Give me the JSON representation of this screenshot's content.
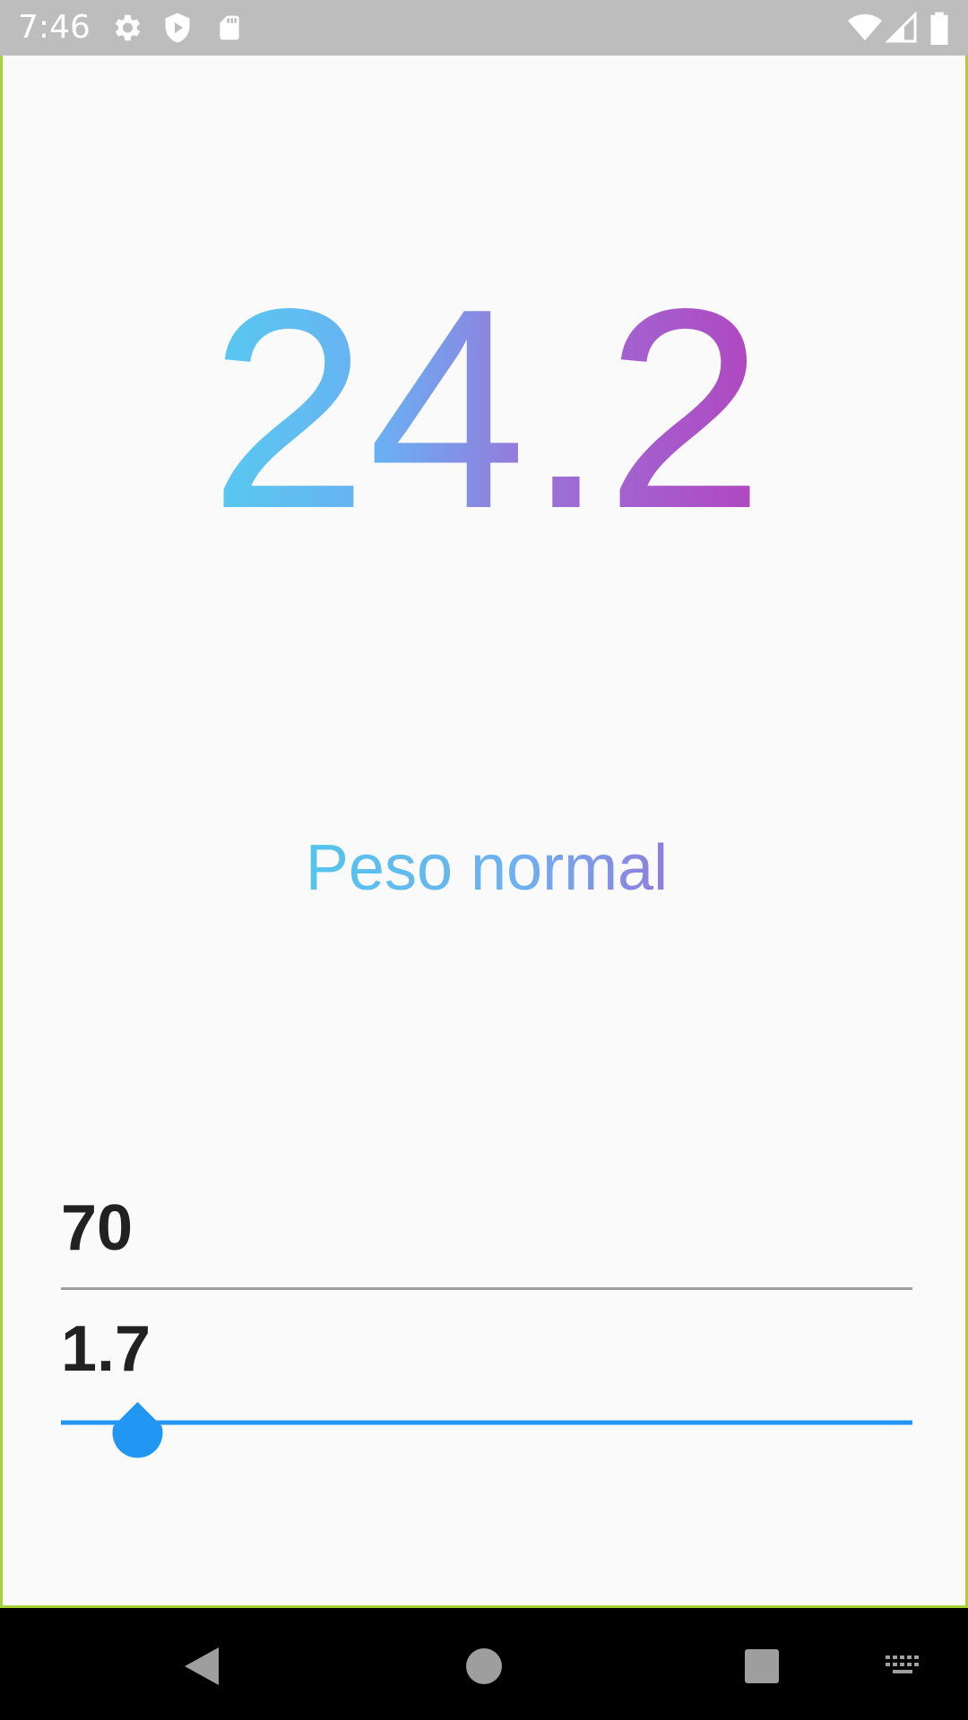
{
  "status_bar": {
    "time": "7:46"
  },
  "bmi": {
    "value": "24.2",
    "gradient": [
      "#58c8ef",
      "#6ab0f3",
      "#9b72d8",
      "#b047c0"
    ]
  },
  "category": {
    "label": "Peso normal"
  },
  "weight": {
    "value": "70"
  },
  "height": {
    "value": "1.7",
    "slider_fraction": 0.09
  },
  "colors": {
    "accent": "#2196f3",
    "background": "#fafafa",
    "status_bar": "#bdbdbd"
  },
  "icons": [
    "settings-icon",
    "shield-play-icon",
    "sd-card-icon",
    "wifi-icon",
    "signal-icon",
    "battery-icon",
    "back-icon",
    "home-icon",
    "recents-icon",
    "keyboard-icon"
  ]
}
